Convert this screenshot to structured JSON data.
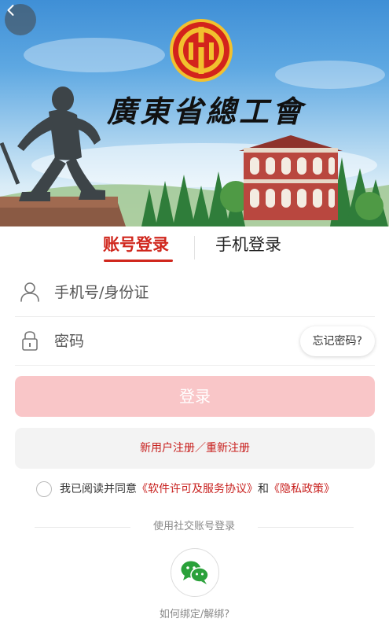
{
  "header": {
    "back_icon": "chevron-left-icon",
    "title": "廣東省總工會",
    "emblem_icon": "trade-union-emblem-icon"
  },
  "tabs": {
    "account": "账号登录",
    "phone": "手机登录",
    "active": "account"
  },
  "form": {
    "username_placeholder": "手机号/身份证",
    "username_value": "",
    "username_icon": "user-icon",
    "password_placeholder": "密码",
    "password_value": "",
    "password_icon": "lock-icon",
    "forgot_label": "忘记密码?"
  },
  "actions": {
    "login_label": "登录",
    "register_label": "新用户注册／重新注册"
  },
  "agreement": {
    "prefix": "我已阅读并同意",
    "software_link": "《软件许可及服务协议》",
    "and": "和",
    "privacy_link": "《隐私政策》",
    "checked": false
  },
  "social": {
    "label": "使用社交账号登录",
    "wechat_icon": "wechat-icon",
    "bind_help": "如何绑定/解绑?"
  },
  "colors": {
    "accent": "#d0271d",
    "login_disabled": "#f9c6c8",
    "link": "#c8201e",
    "wechat": "#2aa13a"
  }
}
